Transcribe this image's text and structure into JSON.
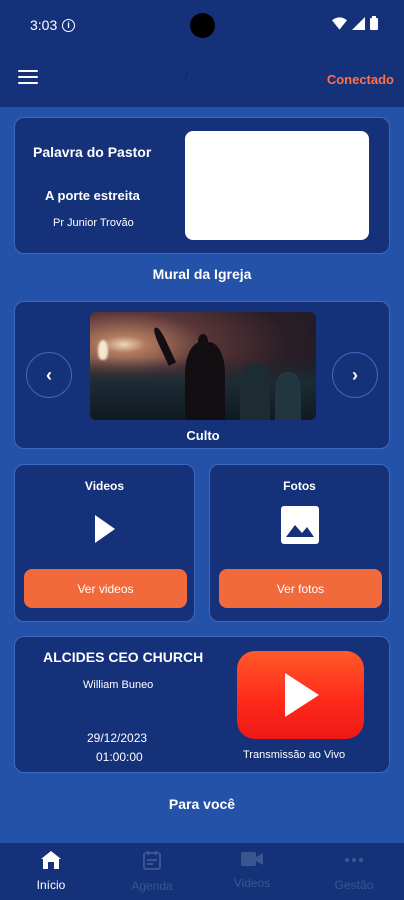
{
  "status": {
    "time": "3:03",
    "info_glyph": "i"
  },
  "appbar": {
    "connection_status": "Conectado"
  },
  "pastor_card": {
    "title": "Palavra do Pastor",
    "subtitle": "A porte estreita",
    "author": "Pr Junior Trovão"
  },
  "mural": {
    "title": "Mural da Igreja",
    "caption": "Culto",
    "prev_glyph": "‹",
    "next_glyph": "›"
  },
  "videos_card": {
    "title": "Videos",
    "button_label": "Ver videos",
    "icon": "play-icon"
  },
  "photos_card": {
    "title": "Fotos",
    "button_label": "Ver fotos",
    "icon": "image-icon"
  },
  "live_card": {
    "church": "ALCIDES CEO CHURCH",
    "person": "William Buneo",
    "date": "29/12/2023",
    "time": "01:00:00",
    "caption": "Transmissão ao Vivo"
  },
  "for_you": {
    "title": "Para você"
  },
  "bottom_nav": {
    "items": [
      {
        "label": "Início",
        "icon": "home-icon",
        "active": true
      },
      {
        "label": "Agenda",
        "icon": "calendar-icon",
        "active": false
      },
      {
        "label": "Videos",
        "icon": "video-camera-icon",
        "active": false
      },
      {
        "label": "Gestão",
        "icon": "more-icon",
        "active": false
      }
    ]
  },
  "colors": {
    "background": "#2452a8",
    "card": "#14317a",
    "accent": "#f26a3c",
    "connected": "#ff7146",
    "youtube": "#ff2a1a"
  }
}
